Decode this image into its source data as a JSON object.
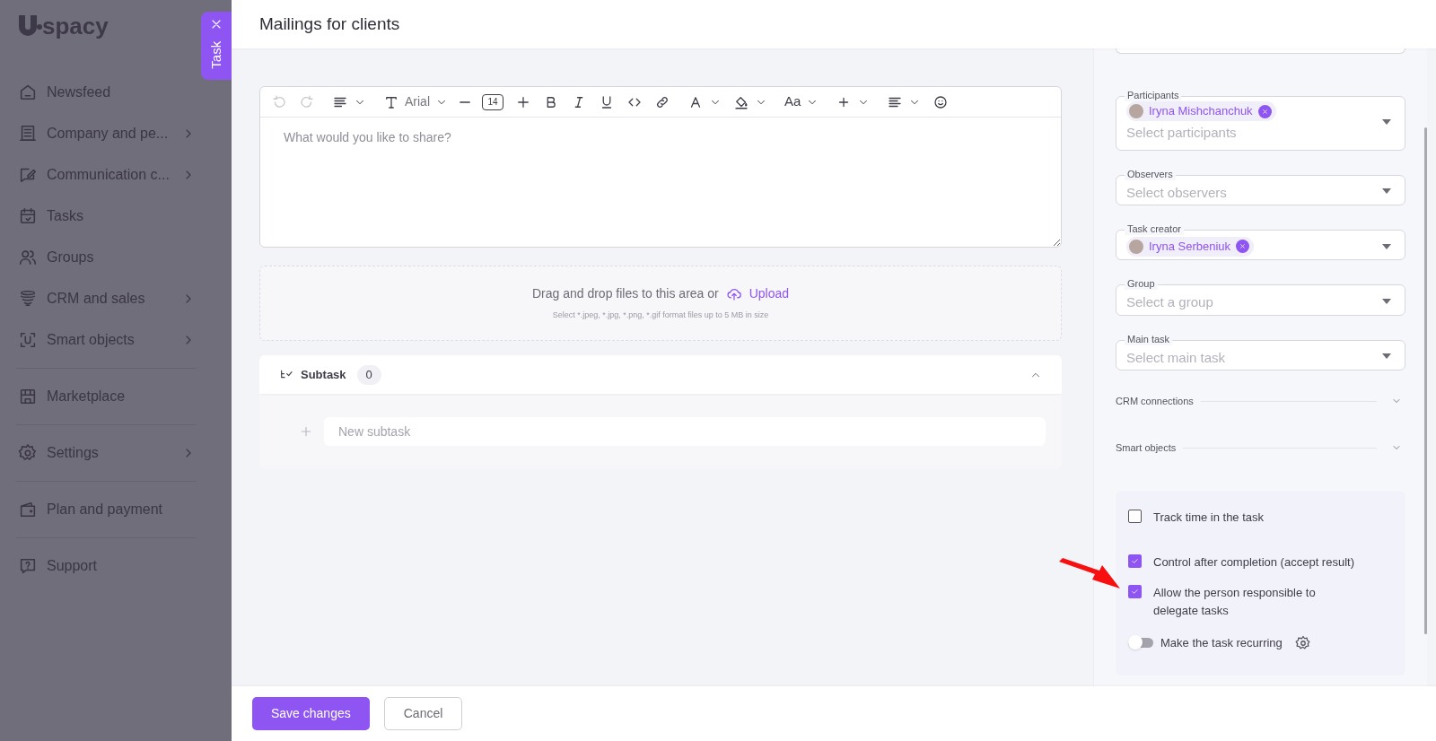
{
  "logo": {
    "text": "spacy"
  },
  "sidebar": {
    "groups": [
      [
        {
          "label": "Newsfeed",
          "expandable": false
        },
        {
          "label": "Company and pe...",
          "expandable": true
        },
        {
          "label": "Communication c...",
          "expandable": true
        },
        {
          "label": "Tasks",
          "expandable": false
        },
        {
          "label": "Groups",
          "expandable": false
        },
        {
          "label": "CRM and sales",
          "expandable": true
        },
        {
          "label": "Smart objects",
          "expandable": true
        }
      ],
      [
        {
          "label": "Marketplace",
          "expandable": false
        }
      ],
      [
        {
          "label": "Settings",
          "expandable": true
        }
      ],
      [
        {
          "label": "Plan and payment",
          "expandable": false
        }
      ],
      [
        {
          "label": "Support",
          "expandable": false
        }
      ]
    ]
  },
  "side_tab": {
    "label": "Task"
  },
  "header": {
    "title": "Mailings for clients"
  },
  "editor": {
    "toolbar": [
      {
        "kind": "undo",
        "dropdown": false,
        "disabled": true
      },
      {
        "kind": "redo",
        "dropdown": false,
        "disabled": true
      },
      {
        "kind": "paragraph",
        "dropdown": true,
        "disabled": false
      },
      {
        "kind": "font",
        "label": "Arial",
        "dropdown": true,
        "disabled": false
      },
      {
        "kind": "minus",
        "dropdown": false,
        "disabled": false
      },
      {
        "kind": "size",
        "label": "14",
        "dropdown": false,
        "disabled": false
      },
      {
        "kind": "plus",
        "dropdown": false,
        "disabled": false
      },
      {
        "kind": "bold",
        "dropdown": false,
        "disabled": false
      },
      {
        "kind": "italic",
        "dropdown": false,
        "disabled": false
      },
      {
        "kind": "underline",
        "dropdown": false,
        "disabled": false
      },
      {
        "kind": "code",
        "dropdown": false,
        "disabled": false
      },
      {
        "kind": "link",
        "dropdown": false,
        "disabled": false
      },
      {
        "kind": "textcolor",
        "dropdown": true,
        "disabled": false
      },
      {
        "kind": "fill",
        "dropdown": true,
        "disabled": false
      },
      {
        "kind": "case",
        "label": "Aa",
        "dropdown": true,
        "disabled": false
      },
      {
        "kind": "insert",
        "dropdown": true,
        "disabled": false
      },
      {
        "kind": "align",
        "dropdown": true,
        "disabled": false
      },
      {
        "kind": "emoji",
        "dropdown": false,
        "disabled": false
      }
    ],
    "placeholder": "What would you like to share?"
  },
  "upload": {
    "text": "Drag and drop files to this area or",
    "link": "Upload",
    "hint": "Select *.jpeg, *.jpg, *.png, *.gif format files up to 5 MB in size"
  },
  "subtask": {
    "title": "Subtask",
    "count": "0",
    "expanded": true,
    "placeholder": "New subtask"
  },
  "fields": [
    {
      "label": "Participants",
      "chips": [
        {
          "name": "Iryna Mishchanchuk"
        }
      ],
      "placeholder": "Select participants"
    },
    {
      "label": "Observers",
      "placeholder": "Select observers"
    },
    {
      "label": "Task creator",
      "chips": [
        {
          "name": "Iryna Serbeniuk"
        }
      ]
    },
    {
      "label": "Group",
      "placeholder": "Select a group"
    },
    {
      "label": "Main task",
      "placeholder": "Select main task"
    }
  ],
  "sections": [
    {
      "label": "CRM connections",
      "expanded": false
    },
    {
      "label": "Smart objects",
      "expanded": false
    }
  ],
  "options": [
    {
      "kind": "checkbox",
      "label": "Track time in the task",
      "checked": false
    },
    {
      "kind": "checkbox",
      "label": "Control after completion (accept result)",
      "checked": true
    },
    {
      "kind": "checkbox",
      "label": "Allow the person responsible to delegate tasks",
      "checked": true
    },
    {
      "kind": "toggle",
      "label": "Make the task recurring",
      "on": false
    }
  ],
  "footer": {
    "buttons": [
      {
        "label": "Save changes",
        "primary": true
      },
      {
        "label": "Cancel",
        "primary": false
      }
    ]
  }
}
